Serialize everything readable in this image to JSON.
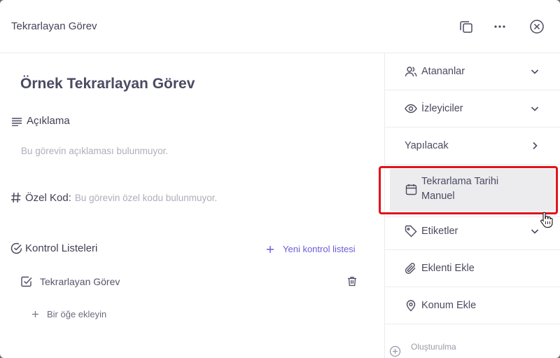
{
  "header": {
    "title": "Tekrarlayan Görev"
  },
  "task": {
    "title": "Örnek Tekrarlayan Görev",
    "description_label": "Açıklama",
    "description_placeholder": "Bu görevin açıklaması bulunmuyor.",
    "custom_code_label": "Özel Kod:",
    "custom_code_placeholder": "Bu görevin özel kodu bulunmuyor."
  },
  "checklists": {
    "label": "Kontrol Listeleri",
    "new_checklist": "Yeni kontrol listesi",
    "items": [
      {
        "title": "Tekrarlayan Görev"
      }
    ],
    "add_item": "Bir öğe ekleyin"
  },
  "sidebar": {
    "assignees": "Atananlar",
    "watchers": "İzleyiciler",
    "status": "Yapılacak",
    "repeat_line1": "Tekrarlama Tarihi",
    "repeat_line2": "Manuel",
    "tags": "Etiketler",
    "attachment": "Eklenti Ekle",
    "location": "Konum Ekle",
    "created": "Oluşturulma"
  },
  "colors": {
    "highlight": "#e0141b",
    "accent": "#6a5cd8"
  }
}
